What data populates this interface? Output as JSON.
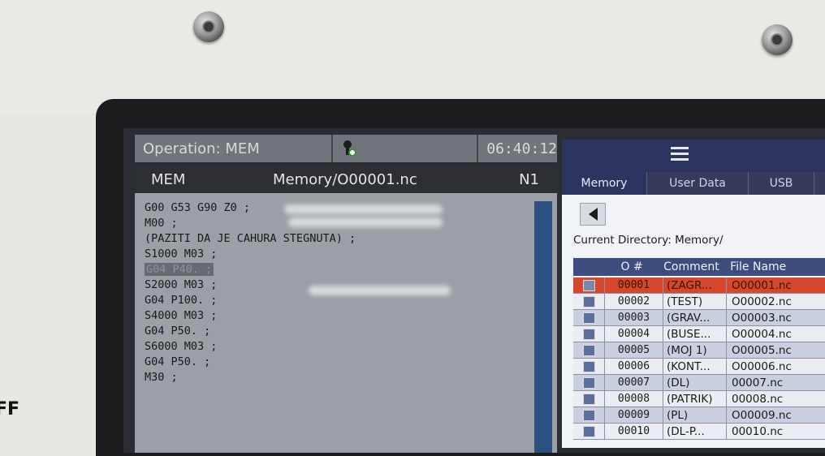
{
  "off_label": "FF",
  "left_panel": {
    "operation": "Operation: MEM",
    "clock": "06:40:12",
    "program_mode": "MEM",
    "program_path": "Memory/O00001.nc",
    "block_number": "N1",
    "code_lines": [
      "G00 G53 G90 Z0 ;",
      "M00 ;",
      "(PAZITI DA JE CAHURA STEGNUTA) ;",
      "S1000 M03 ;",
      "G04 P40. ;",
      "S2000 M03 ;",
      "G04 P100. ;",
      "S4000 M03 ;",
      "G04 P50. ;",
      "S6000 M03 ;",
      "G04 P50. ;",
      "M30 ;"
    ],
    "active_line_index": 4
  },
  "right_panel": {
    "tabs": [
      {
        "label": "Memory",
        "active": true
      },
      {
        "label": "User Data",
        "active": false
      },
      {
        "label": "USB",
        "active": false
      }
    ],
    "current_directory": "Current Directory: Memory/",
    "table": {
      "headers": [
        "O #",
        "Comment",
        "File Name"
      ],
      "rows": [
        {
          "o": "00001",
          "comment": "(ZAGR...",
          "file": "O00001.nc",
          "selected": true
        },
        {
          "o": "00002",
          "comment": "(TEST)",
          "file": "O00002.nc",
          "selected": false
        },
        {
          "o": "00003",
          "comment": "(GRAV...",
          "file": "O00003.nc",
          "selected": false
        },
        {
          "o": "00004",
          "comment": "(BUSE...",
          "file": "O00004.nc",
          "selected": false
        },
        {
          "o": "00005",
          "comment": "(MOJ 1)",
          "file": "O00005.nc",
          "selected": false
        },
        {
          "o": "00006",
          "comment": "(KONT...",
          "file": "O00006.nc",
          "selected": false
        },
        {
          "o": "00007",
          "comment": "(DL)",
          "file": "00007.nc",
          "selected": false
        },
        {
          "o": "00008",
          "comment": "(PATRIK)",
          "file": "00008.nc",
          "selected": false
        },
        {
          "o": "00009",
          "comment": "(PL)",
          "file": "O00009.nc",
          "selected": false
        },
        {
          "o": "00010",
          "comment": "(DL-P...",
          "file": "00010.nc",
          "selected": false
        }
      ]
    }
  },
  "icons": {
    "spindle": "spindle-status-icon",
    "menu": "menu-icon",
    "back": "back-arrow-icon"
  },
  "colors": {
    "selected_row": "#d4472a",
    "header_bar": "#2e3460",
    "table_header": "#3f4c7e"
  }
}
